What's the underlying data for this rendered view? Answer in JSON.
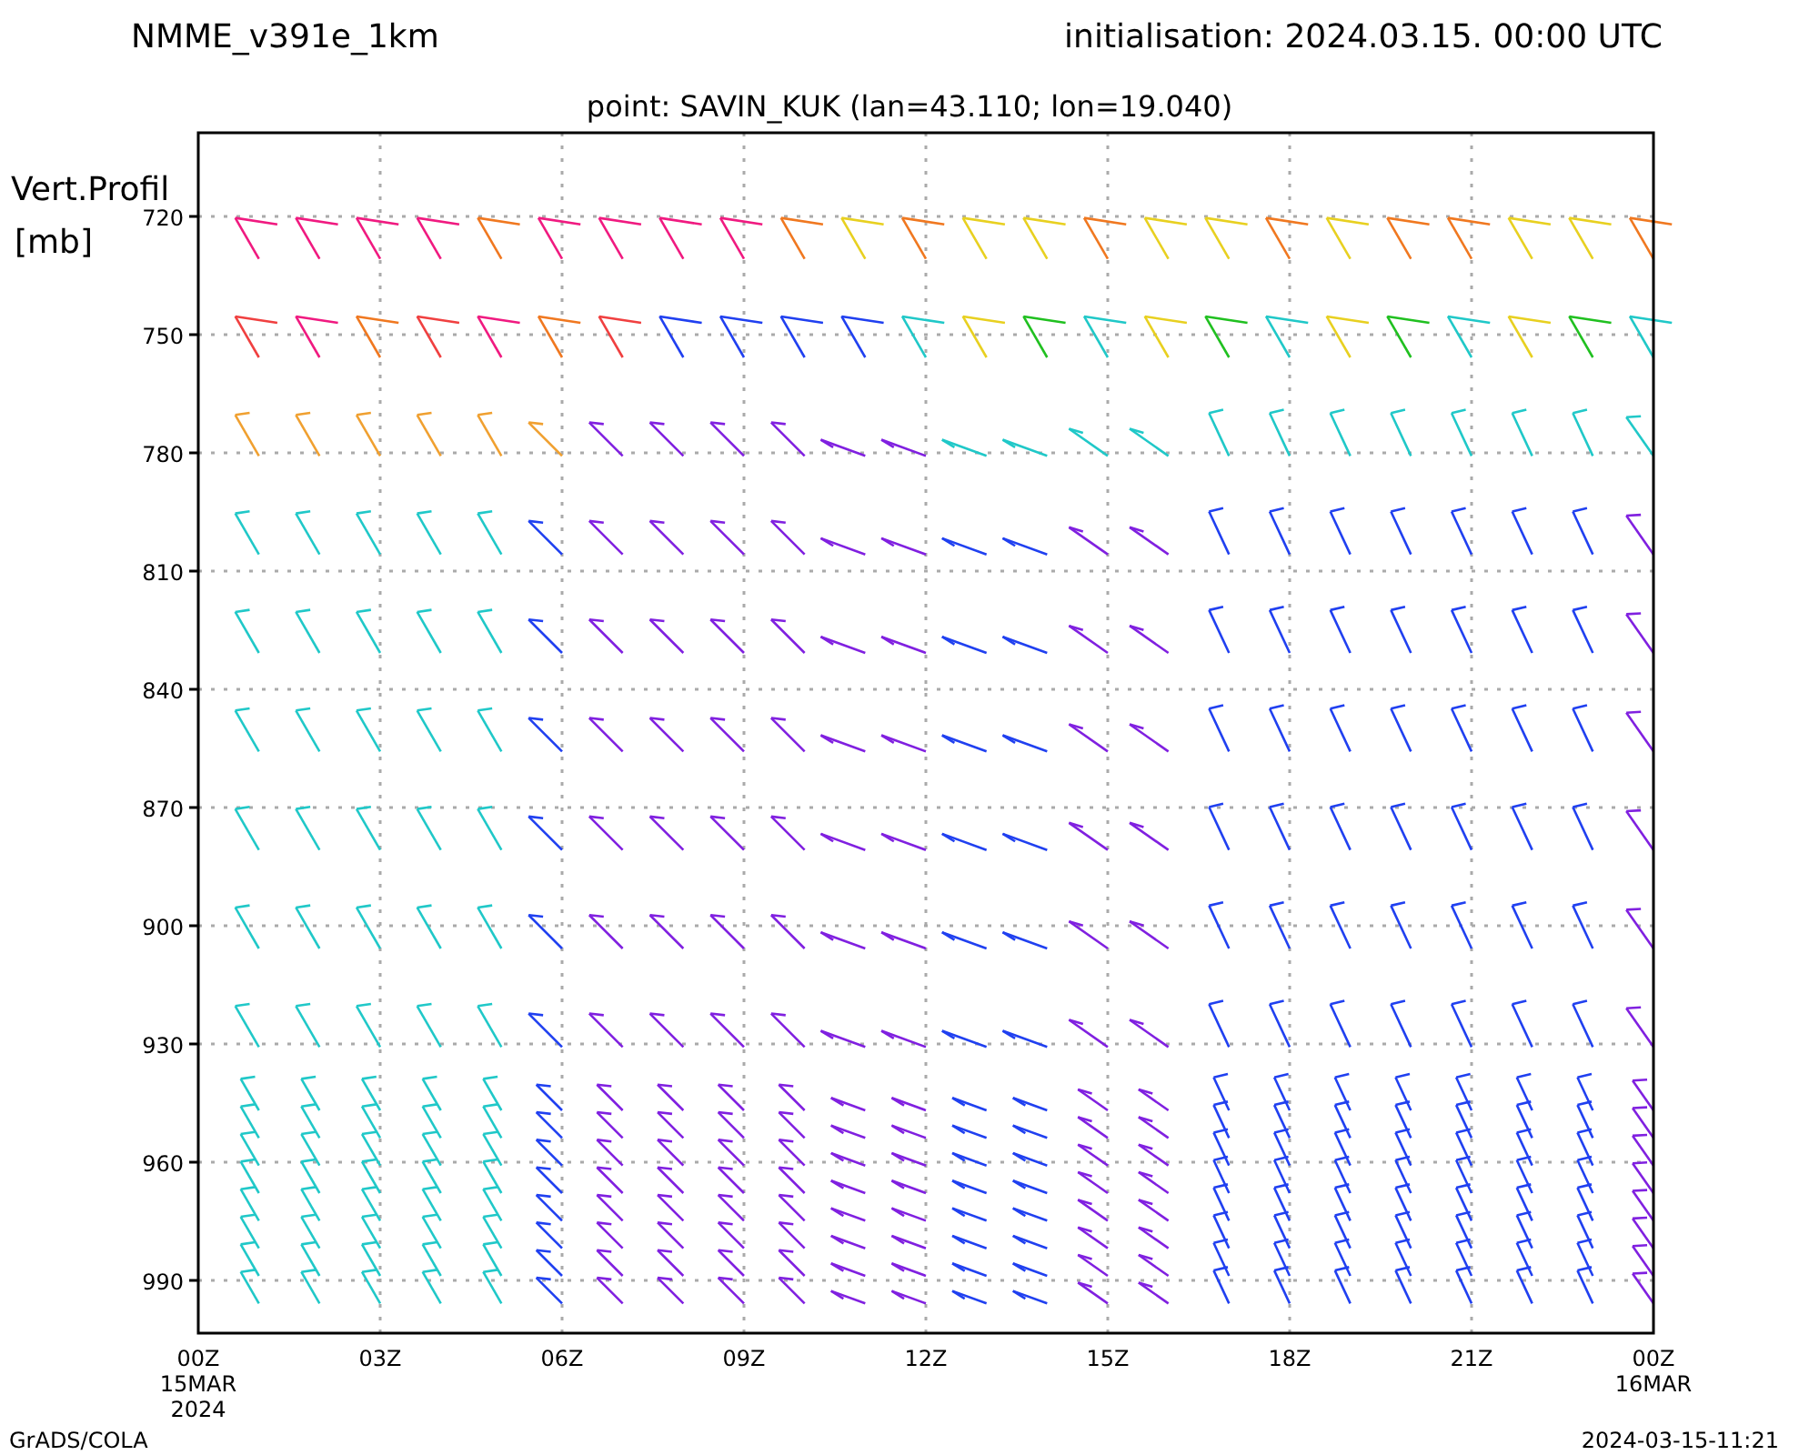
{
  "header": {
    "model": "NMME_v391e_1km",
    "initialisation": "initialisation: 2024.03.15. 00:00 UTC",
    "point": "point: SAVIN_KUK (lan=43.110; lon=19.040)"
  },
  "y_axis": {
    "title": "Vert.Profil",
    "unit": "[mb]",
    "ticks": [
      "720",
      "750",
      "780",
      "810",
      "840",
      "870",
      "900",
      "930",
      "960",
      "990"
    ]
  },
  "x_axis": {
    "ticks": [
      {
        "label": "00Z",
        "date": "15MAR",
        "year": "2024"
      },
      {
        "label": "03Z"
      },
      {
        "label": "06Z"
      },
      {
        "label": "09Z"
      },
      {
        "label": "12Z"
      },
      {
        "label": "15Z"
      },
      {
        "label": "18Z"
      },
      {
        "label": "21Z"
      },
      {
        "label": "00Z",
        "date": "16MAR"
      }
    ]
  },
  "footer": {
    "credit": "GrADS/COLA",
    "timestamp": "2024-03-15-11:21"
  }
}
